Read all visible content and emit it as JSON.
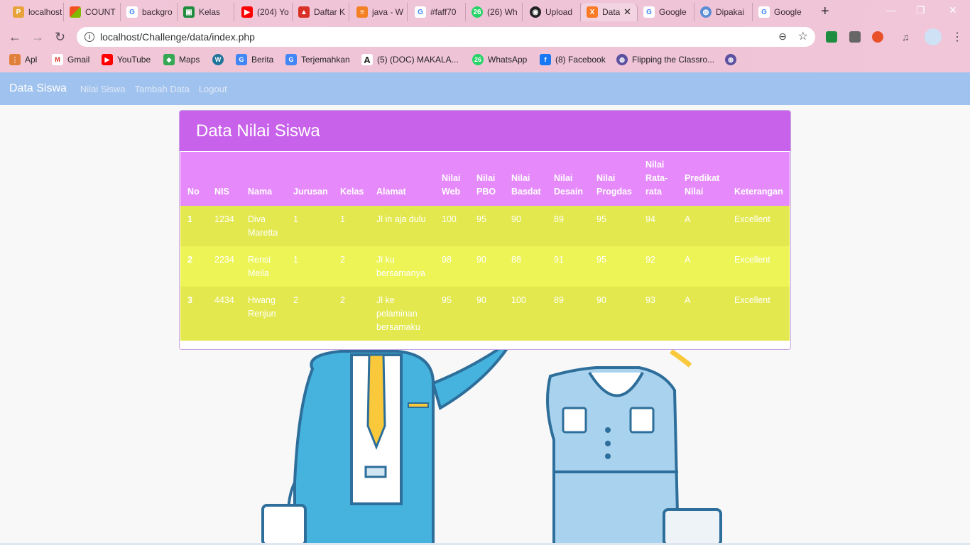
{
  "browser": {
    "tabs": [
      {
        "label": "localhost",
        "favicon": "phpmyadmin-icon",
        "color": "#e8a23a"
      },
      {
        "label": "COUNT",
        "favicon": "microsoft-icon",
        "color": "#f25022"
      },
      {
        "label": "backgro",
        "favicon": "google-icon",
        "color": "#4285f4"
      },
      {
        "label": "Kelas",
        "favicon": "classroom-icon",
        "color": "#1e8e3e"
      },
      {
        "label": "(204) Yo",
        "favicon": "youtube-icon",
        "color": "#ff0000"
      },
      {
        "label": "Daftar K",
        "favicon": "chart-icon",
        "color": "#d93025"
      },
      {
        "label": "java - W",
        "favicon": "stackoverflow-icon",
        "color": "#f48024"
      },
      {
        "label": "#faff70",
        "favicon": "google-icon",
        "color": "#4285f4"
      },
      {
        "label": "(26) Wh",
        "favicon": "whatsapp-icon",
        "color": "#25d366"
      },
      {
        "label": "Upload",
        "favicon": "github-icon",
        "color": "#222222"
      },
      {
        "label": "Data",
        "favicon": "xampp-icon",
        "color": "#fb7a24"
      },
      {
        "label": "Google",
        "favicon": "google-icon",
        "color": "#4285f4"
      },
      {
        "label": "Dipakai",
        "favicon": "globe-icon",
        "color": "#5b8dd6"
      },
      {
        "label": "Google",
        "favicon": "google-icon",
        "color": "#4285f4"
      }
    ],
    "close_glyph": "✕",
    "new_tab_glyph": "+",
    "url": "localhost/Challenge/data/index.php",
    "bookmarks": [
      {
        "label": "Apl",
        "icon": "apps-icon",
        "color": "#e0803a"
      },
      {
        "label": "Gmail",
        "icon": "gmail-icon",
        "color": "#d93025"
      },
      {
        "label": "YouTube",
        "icon": "youtube-icon",
        "color": "#ff0000"
      },
      {
        "label": "Maps",
        "icon": "maps-icon",
        "color": "#34a853"
      },
      {
        "label": "",
        "icon": "wordpress-icon",
        "color": "#21759b"
      },
      {
        "label": "Berita",
        "icon": "news-icon",
        "color": "#4285f4"
      },
      {
        "label": "Terjemahkan",
        "icon": "translate-icon",
        "color": "#4285f4"
      },
      {
        "label": "(5) (DOC) MAKALA...",
        "icon": "academia-icon",
        "color": "#222222"
      },
      {
        "label": "WhatsApp",
        "icon": "whatsapp-icon",
        "color": "#25d366"
      },
      {
        "label": "(8) Facebook",
        "icon": "facebook-icon",
        "color": "#1877f2"
      },
      {
        "label": "Flipping the Classro...",
        "icon": "globe-icon",
        "color": "#5b4fa0"
      },
      {
        "label": "",
        "icon": "globe-icon",
        "color": "#5b4fa0"
      }
    ]
  },
  "navbar": {
    "brand": "Data Siswa",
    "links": [
      "Nilai Siswa",
      "Tambah Data",
      "Logout"
    ],
    "color": "#a0c2ee"
  },
  "card": {
    "title": "Data Nilai Siswa",
    "header_color": "#c862ea",
    "table_header_color": "#e689fb",
    "row_colors": [
      "#e3e84e",
      "#edf455"
    ]
  },
  "table": {
    "headers": [
      "No",
      "NIS",
      "Nama",
      "Jurusan",
      "Kelas",
      "Alamat",
      "Nilai Web",
      "Nilai PBO",
      "Nilai Basdat",
      "Nilai Desain",
      "Nilai Progdas",
      "Nilai Rata-rata",
      "Predikat Nilai",
      "Keterangan"
    ],
    "rows": [
      [
        "1",
        "1234",
        "Diva Maretta",
        "1",
        "1",
        "Jl in aja dulu",
        "100",
        "95",
        "90",
        "89",
        "95",
        "94",
        "A",
        "Excellent"
      ],
      [
        "2",
        "2234",
        "Rensi Meila",
        "1",
        "2",
        "Jl ku bersamanya",
        "98",
        "90",
        "88",
        "91",
        "95",
        "92",
        "A",
        "Excellent"
      ],
      [
        "3",
        "4434",
        "Hwang Renjun",
        "2",
        "2",
        "Jl ke pelaminan bersamaku",
        "95",
        "90",
        "100",
        "89",
        "90",
        "93",
        "A",
        "Excellent"
      ]
    ]
  }
}
